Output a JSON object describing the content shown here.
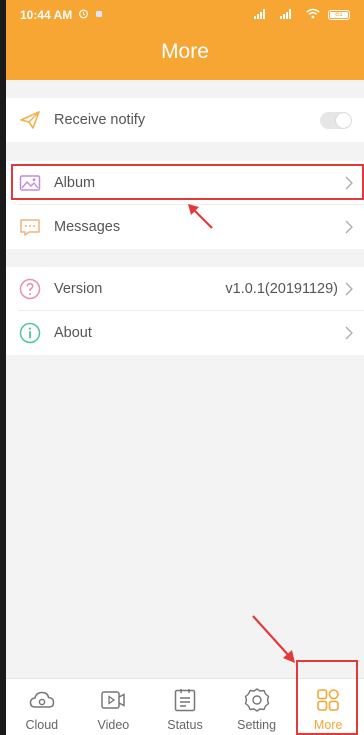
{
  "status_bar": {
    "time": "10:44 AM",
    "battery": "81"
  },
  "header": {
    "title": "More"
  },
  "settings": {
    "receive_notify": {
      "label": "Receive notify",
      "enabled": false
    },
    "album": {
      "label": "Album"
    },
    "messages": {
      "label": "Messages"
    },
    "version": {
      "label": "Version",
      "value": "v1.0.1(20191129)"
    },
    "about": {
      "label": "About"
    }
  },
  "tabbar": {
    "items": [
      {
        "label": "Cloud",
        "icon": "cloud-icon"
      },
      {
        "label": "Video",
        "icon": "video-icon"
      },
      {
        "label": "Status",
        "icon": "status-icon"
      },
      {
        "label": "Setting",
        "icon": "setting-icon"
      },
      {
        "label": "More",
        "icon": "more-grid-icon"
      }
    ],
    "active": "More"
  },
  "colors": {
    "accent": "#f7a633",
    "annotation": "#e23a3a",
    "album_icon": "#c58bd9",
    "messages_icon": "#f3b27a",
    "version_icon": "#e98fb0",
    "about_icon": "#4cc79a"
  }
}
